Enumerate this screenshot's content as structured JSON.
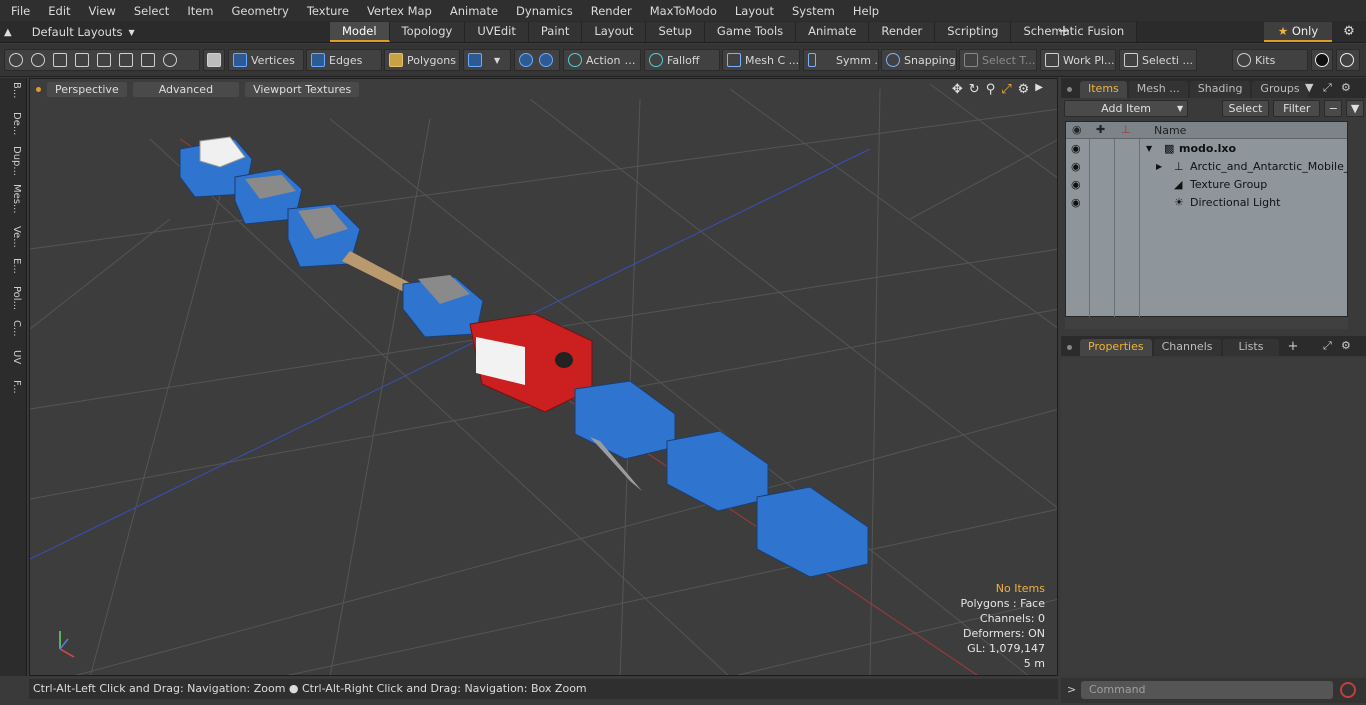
{
  "menu": [
    "File",
    "Edit",
    "View",
    "Select",
    "Item",
    "Geometry",
    "Texture",
    "Vertex Map",
    "Animate",
    "Dynamics",
    "Render",
    "MaxToModo",
    "Layout",
    "System",
    "Help"
  ],
  "layout_selector": "Default Layouts",
  "tabs": [
    "Model",
    "Topology",
    "UVEdit",
    "Paint",
    "Layout",
    "Setup",
    "Game Tools",
    "Animate",
    "Render",
    "Scripting",
    "Schematic Fusion"
  ],
  "only_label": "Only",
  "toolbar": {
    "vertices": "Vertices",
    "edges": "Edges",
    "polygons": "Polygons",
    "action": "Action",
    "falloff": "Falloff",
    "mesh": "Mesh C ...",
    "symm": "Symm ...",
    "snapping": "Snapping",
    "select_t": "Select T...",
    "work_pl": "Work Pl...",
    "selecti": "Selecti ...",
    "kits": "Kits"
  },
  "left_tabs": [
    "B...",
    "De...",
    "Dup...",
    "Mes...",
    "Ve...",
    "E...",
    "Pol...",
    "C...",
    "UV",
    "F..."
  ],
  "viewport": {
    "perspective": "Perspective",
    "advanced": "Advanced",
    "textures": "Viewport Textures",
    "stats": [
      "No Items",
      "Polygons : Face",
      "Channels: 0",
      "Deformers: ON",
      "GL: 1,079,147",
      "5 m"
    ]
  },
  "status": "Ctrl-Alt-Left Click and Drag: Navigation: Zoom ● Ctrl-Alt-Right Click and Drag: Navigation: Box Zoom",
  "items_panel": {
    "tabs": [
      "Items",
      "Mesh ...",
      "Shading",
      "Groups"
    ],
    "add_item": "Add Item",
    "select": "Select",
    "filter": "Filter",
    "name_header": "Name",
    "rows": [
      "modo.lxo",
      "Arctic_and_Antarctic_Mobile_...",
      "Texture Group",
      "Directional Light"
    ]
  },
  "props_panel": {
    "tabs": [
      "Properties",
      "Channels",
      "Lists"
    ]
  },
  "command_placeholder": "Command"
}
